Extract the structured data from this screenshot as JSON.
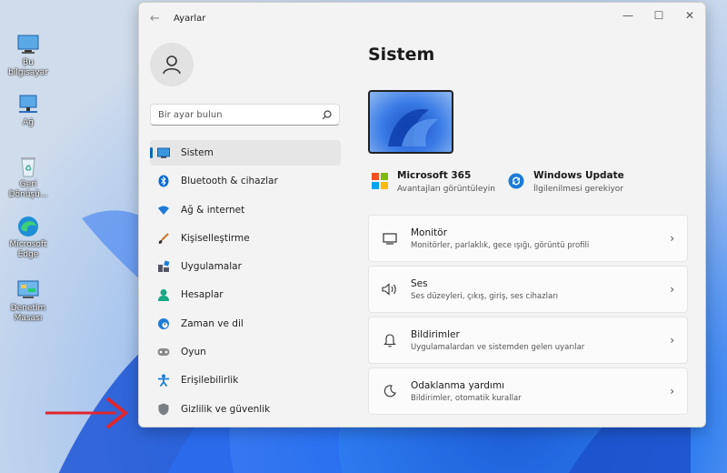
{
  "desktop": {
    "icons": [
      {
        "label": "Bu bilgisayar",
        "icon": "computer-icon"
      },
      {
        "label": "Ağ",
        "icon": "network-icon"
      },
      {
        "label": "Geri Dönüşü...",
        "icon": "recycle-bin-icon"
      },
      {
        "label": "Microsoft Edge",
        "icon": "edge-icon"
      },
      {
        "label": "Denetim Masası",
        "icon": "control-panel-icon"
      }
    ]
  },
  "window": {
    "title": "Ayarlar",
    "controls": {
      "minimize": "—",
      "maximize": "☐",
      "close": "✕"
    }
  },
  "sidebar": {
    "search_placeholder": "Bir ayar bulun",
    "items": [
      {
        "label": "Sistem",
        "icon": "monitor-icon",
        "active": true
      },
      {
        "label": "Bluetooth & cihazlar",
        "icon": "bluetooth-icon"
      },
      {
        "label": "Ağ & internet",
        "icon": "wifi-icon"
      },
      {
        "label": "Kişiselleştirme",
        "icon": "brush-icon"
      },
      {
        "label": "Uygulamalar",
        "icon": "apps-icon"
      },
      {
        "label": "Hesaplar",
        "icon": "person-icon"
      },
      {
        "label": "Zaman ve dil",
        "icon": "globe-clock-icon"
      },
      {
        "label": "Oyun",
        "icon": "gamepad-icon"
      },
      {
        "label": "Erişilebilirlik",
        "icon": "accessibility-icon"
      },
      {
        "label": "Gizlilik ve güvenlik",
        "icon": "shield-icon"
      }
    ]
  },
  "main": {
    "title": "Sistem",
    "quick": [
      {
        "title": "Microsoft 365",
        "subtitle": "Avantajları görüntüleyin",
        "icon": "microsoft-logo-icon"
      },
      {
        "title": "Windows Update",
        "subtitle": "İlgilenilmesi gerekiyor",
        "icon": "update-icon"
      }
    ],
    "cards": [
      {
        "title": "Monitör",
        "subtitle": "Monitörler, parlaklık, gece ışığı, görüntü profili",
        "icon": "display-icon"
      },
      {
        "title": "Ses",
        "subtitle": "Ses düzeyleri, çıkış, giriş, ses cihazları",
        "icon": "speaker-icon"
      },
      {
        "title": "Bildirimler",
        "subtitle": "Uygulamalardan ve sistemden gelen uyarılar",
        "icon": "bell-icon"
      },
      {
        "title": "Odaklanma yardımı",
        "subtitle": "Bildirimler, otomatik kurallar",
        "icon": "moon-icon"
      }
    ]
  },
  "colors": {
    "accent": "#0067c0",
    "arrow": "#e0262e"
  }
}
